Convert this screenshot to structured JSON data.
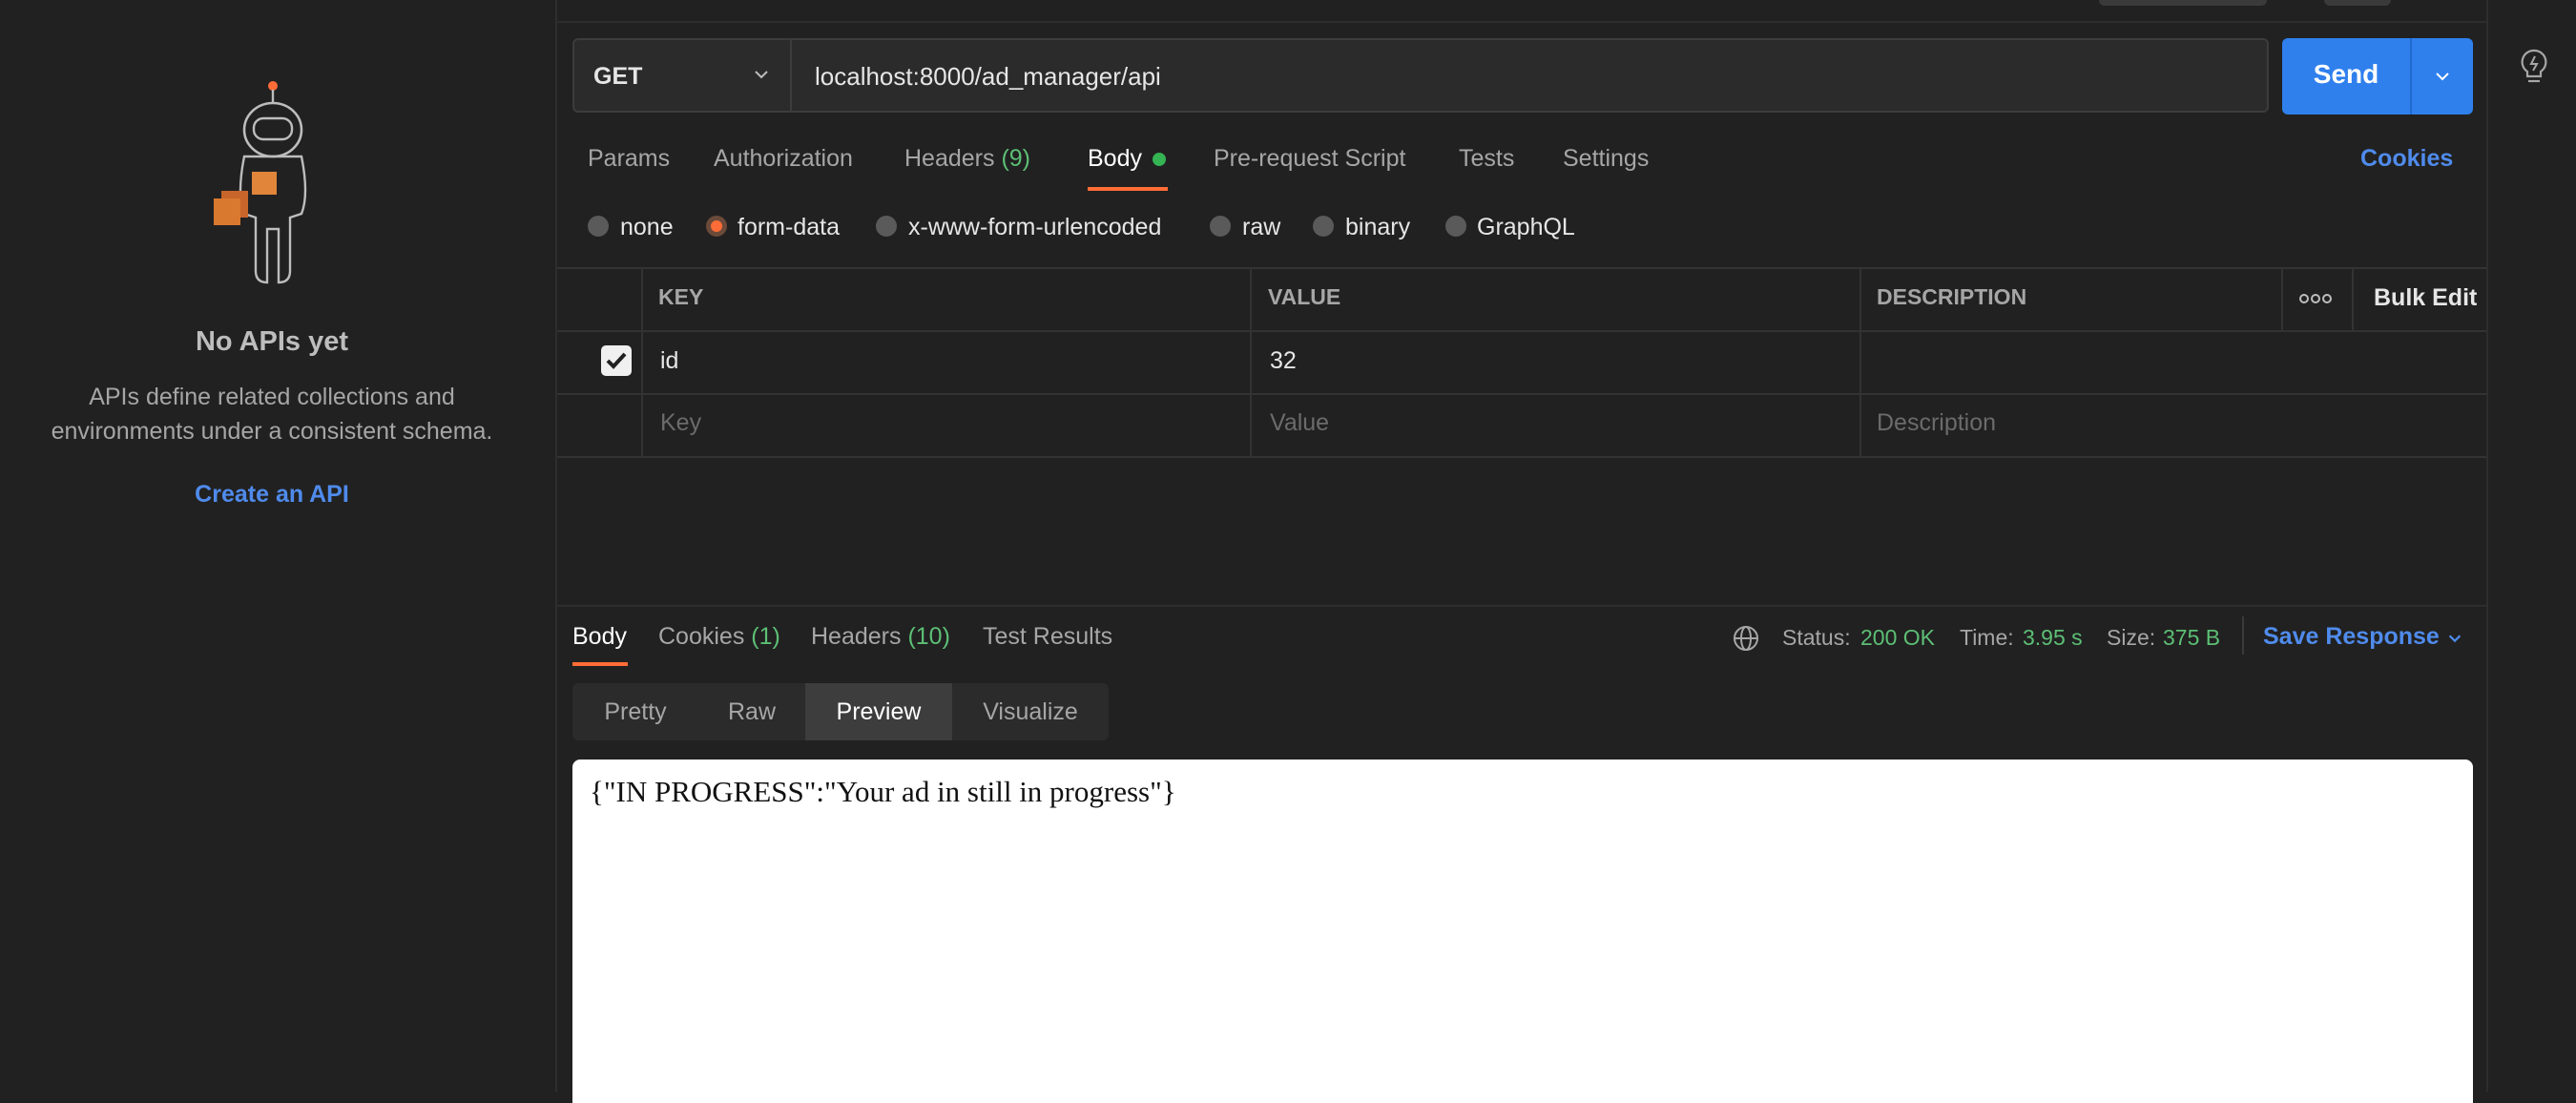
{
  "sidebar": {
    "empty_title": "No APIs yet",
    "empty_description": "APIs define related collections and environments under a consistent schema.",
    "create_link": "Create an API"
  },
  "request": {
    "method": "GET",
    "url": "localhost:8000/ad_manager/api",
    "send_label": "Send",
    "tabs": {
      "params": "Params",
      "authorization": "Authorization",
      "headers": "Headers",
      "headers_count": "(9)",
      "body": "Body",
      "pre_request": "Pre-request Script",
      "tests": "Tests",
      "settings": "Settings"
    },
    "cookies_link": "Cookies",
    "body_types": [
      "none",
      "form-data",
      "x-www-form-urlencoded",
      "raw",
      "binary",
      "GraphQL"
    ],
    "selected_body_type": "form-data",
    "form_table": {
      "headers": {
        "key": "KEY",
        "value": "VALUE",
        "description": "DESCRIPTION"
      },
      "bulk_edit": "Bulk Edit",
      "rows": [
        {
          "checked": true,
          "key": "id",
          "value": "32",
          "description": ""
        }
      ],
      "placeholders": {
        "key": "Key",
        "value": "Value",
        "description": "Description"
      }
    }
  },
  "response": {
    "tabs": {
      "body": "Body",
      "cookies": "Cookies",
      "cookies_count": "(1)",
      "headers": "Headers",
      "headers_count": "(10)",
      "test_results": "Test Results"
    },
    "status_label": "Status:",
    "status_value": "200 OK",
    "time_label": "Time:",
    "time_value": "3.95 s",
    "size_label": "Size:",
    "size_value": "375 B",
    "save_response": "Save Response",
    "view_modes": [
      "Pretty",
      "Raw",
      "Preview",
      "Visualize"
    ],
    "active_view_mode": "Preview",
    "preview_content": "{\"IN PROGRESS\":\"Your ad in still in progress\"}"
  },
  "colors": {
    "accent_orange": "#ff6c37",
    "link_blue": "#4f8bec",
    "send_blue": "#2f80ed",
    "success_green": "#5cbf75"
  },
  "icons": [
    "astronaut-illustration",
    "chevron-down-icon",
    "lightbulb-icon",
    "globe-icon",
    "more-horizontal-icon",
    "checkbox-checked-icon"
  ]
}
